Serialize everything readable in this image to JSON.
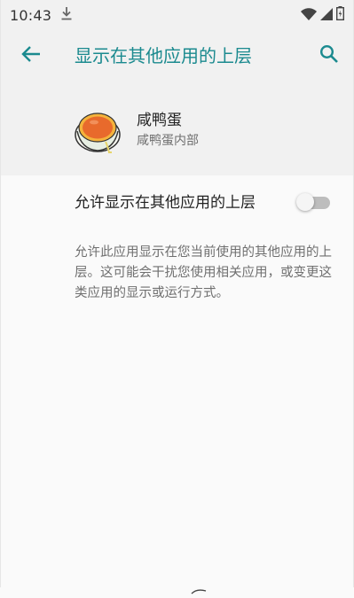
{
  "status_bar": {
    "time": "10:43",
    "icons": [
      "download-icon",
      "wifi-icon",
      "signal-icon",
      "battery-icon"
    ]
  },
  "app_bar": {
    "title": "显示在其他应用的上层",
    "back_icon": "arrow-left-icon",
    "search_icon": "search-icon"
  },
  "app_header": {
    "name": "咸鸭蛋",
    "subtitle": "咸鸭蛋内部",
    "icon": "salted-egg-icon"
  },
  "permission": {
    "label": "允许显示在其他应用的上层",
    "enabled": false
  },
  "description": "允许此应用显示在您当前使用的其他应用的上层。这可能会干扰您使用相关应用，或变更这类应用的显示或运行方式。",
  "colors": {
    "accent": "#1b8a8f",
    "background": "#fafafa",
    "header_background": "#f1f1f1",
    "switch_off_track": "#bdbdbd",
    "secondary_text": "#6f6f6f"
  }
}
